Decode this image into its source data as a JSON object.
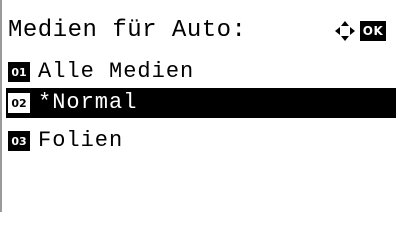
{
  "screen": {
    "title": "Medien für Auto:",
    "nav_icon": "four-way-arrows-icon",
    "ok_label": "OK"
  },
  "menu": {
    "items": [
      {
        "number": "01",
        "label": "Alle Medien",
        "selected": false
      },
      {
        "number": "02",
        "label": "*Normal",
        "selected": true
      },
      {
        "number": "03",
        "label": "Folien",
        "selected": false
      }
    ]
  },
  "colors": {
    "background": "#ffffff",
    "text": "#000000",
    "highlight_bg": "#000000",
    "highlight_text": "#ffffff"
  }
}
